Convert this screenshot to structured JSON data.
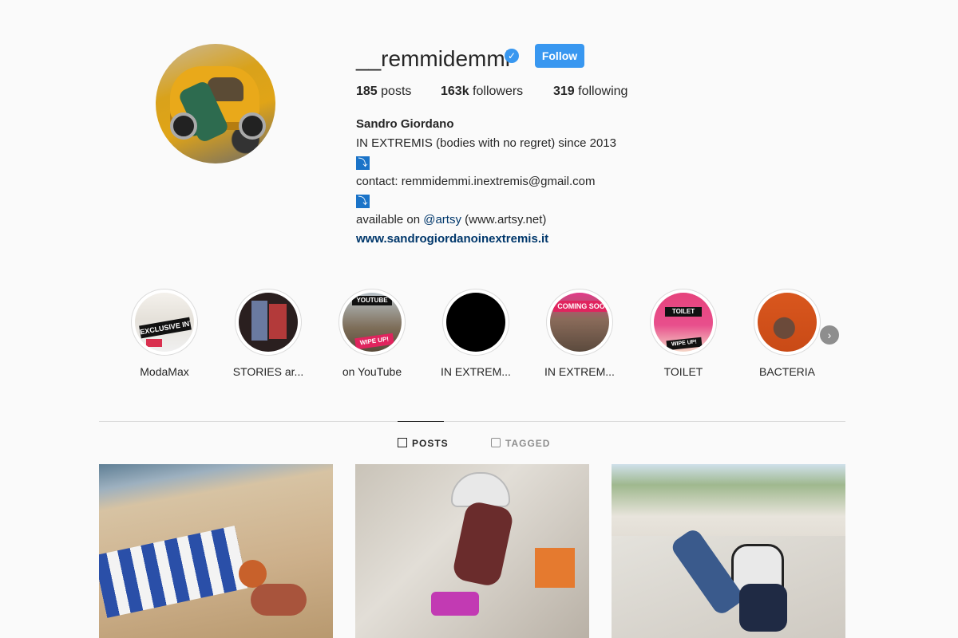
{
  "profile": {
    "username": "__remmidemmi",
    "follow_label": "Follow",
    "posts_count": "185",
    "posts_label": "posts",
    "followers_count": "163k",
    "followers_label": "followers",
    "following_count": "319",
    "following_label": "following",
    "full_name": "Sandro Giordano",
    "bio_line1": "IN EXTREMIS (bodies with no regret) since 2013",
    "bio_emoji": "⤵",
    "bio_contact": "contact: remmidemmi.inextremis@gmail.com",
    "bio_available_prefix": "available on ",
    "bio_mention": "@artsy",
    "bio_available_suffix": " (www.artsy.net)",
    "website": "www.sandrogiordanoinextremis.it"
  },
  "highlights": [
    {
      "label": "ModaMax"
    },
    {
      "label": "STORIES ar..."
    },
    {
      "label": "on YouTube"
    },
    {
      "label": "IN EXTREM..."
    },
    {
      "label": "IN EXTREM..."
    },
    {
      "label": "TOILET"
    },
    {
      "label": "BACTERIA"
    }
  ],
  "highlight_thumb_text": {
    "moda_max": "EXCLUSIVE INTERVIEW",
    "youtube_top": "YOUTUBE",
    "youtube_bottom": "WIPE UP!",
    "coming_soon": "COMING SOO",
    "toilet_top": "TOILET",
    "toilet_bottom": "WIPE UP!"
  },
  "tabs": {
    "posts": "POSTS",
    "tagged": "TAGGED"
  },
  "colors": {
    "accent": "#3897f0",
    "link": "#00376b",
    "background": "#fafafa"
  }
}
